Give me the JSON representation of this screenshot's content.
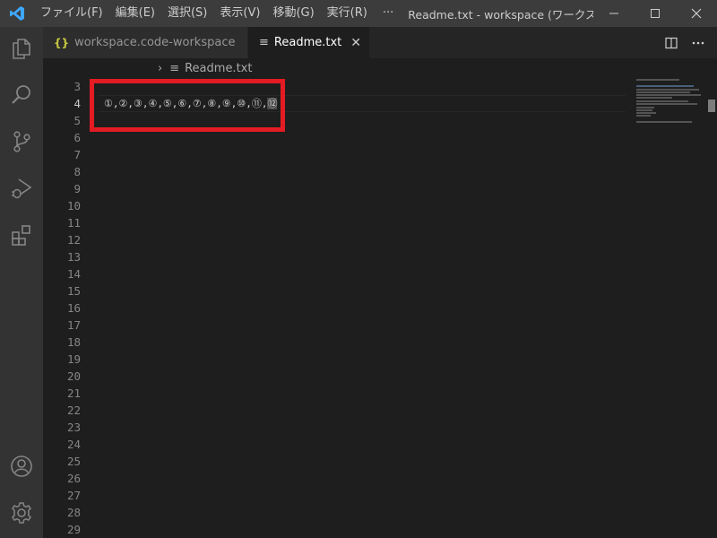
{
  "titlebar": {
    "menus": [
      "ファイル(F)",
      "編集(E)",
      "選択(S)",
      "表示(V)",
      "移動(G)",
      "実行(R)"
    ],
    "more": "···",
    "window_title": "Readme.txt - workspace (ワークスペース) - Vi"
  },
  "tabs": [
    {
      "icon": "{}",
      "label": "workspace.code-workspace",
      "active": false
    },
    {
      "icon": "≡",
      "label": "Readme.txt",
      "active": true,
      "close": "✕"
    }
  ],
  "breadcrumb": {
    "chevron": "›",
    "file_icon": "≡",
    "file": "Readme.txt"
  },
  "editor": {
    "line_numbers": [
      "3",
      "4",
      "5",
      "6",
      "7",
      "8",
      "9",
      "10",
      "11",
      "12",
      "13",
      "14",
      "15",
      "16",
      "17",
      "18",
      "19",
      "20",
      "21",
      "22",
      "23",
      "24",
      "25",
      "26",
      "27",
      "28",
      "29"
    ],
    "current_line": "4",
    "line4_text": "①,②,③,④,⑤,⑥,⑦,⑧,⑨,⑩,⑪,",
    "line4_cursor_char": "⑫"
  },
  "colors": {
    "accent_blue": "#3ea7ff",
    "highlight_red": "#e31b23",
    "json_icon_yellow": "#cbcb41"
  }
}
